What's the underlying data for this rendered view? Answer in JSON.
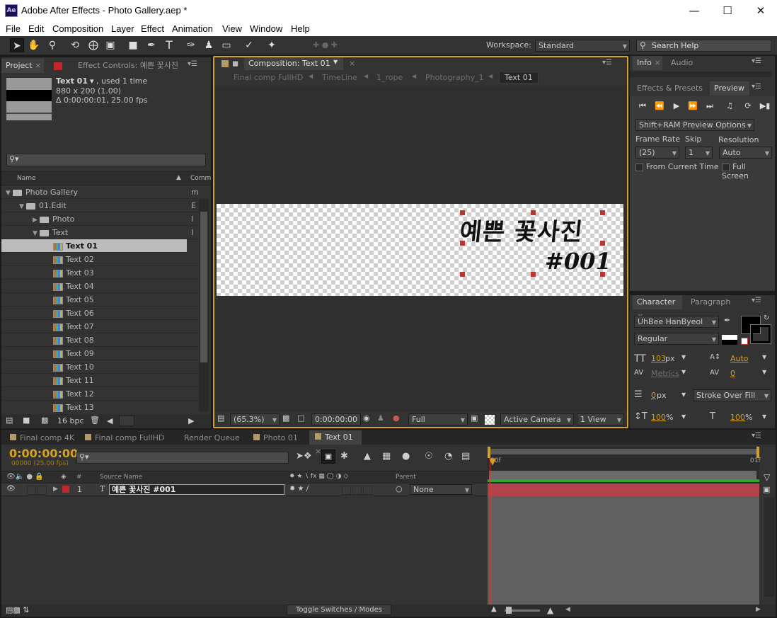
{
  "app": {
    "title": "Adobe After Effects - Photo Gallery.aep *",
    "icon": "Ae"
  },
  "menu": [
    "File",
    "Edit",
    "Composition",
    "Layer",
    "Effect",
    "Animation",
    "View",
    "Window",
    "Help"
  ],
  "toolbar": {
    "workspace_label": "Workspace:",
    "workspace_value": "Standard",
    "search_placeholder": "Search Help"
  },
  "project": {
    "tab_label": "Project",
    "effect_controls_label": "Effect Controls: 예쁜 꽃사진",
    "item_name": "Text 01",
    "item_used": ", used 1 time",
    "item_dims": "880 x 200 (1.00)",
    "item_duration": "Δ 0:00:00:01, 25.00 fps",
    "col_name": "Name",
    "col_comment": "Comm",
    "rows": [
      {
        "label": "Photo Gallery",
        "indent": 0,
        "kind": "folder",
        "open": true,
        "comment": "m"
      },
      {
        "label": "01.Edit",
        "indent": 1,
        "kind": "folder",
        "open": true,
        "comment": "E"
      },
      {
        "label": "Photo",
        "indent": 2,
        "kind": "folder",
        "open": false,
        "comment": "I"
      },
      {
        "label": "Text",
        "indent": 2,
        "kind": "folder",
        "open": true,
        "comment": "I"
      },
      {
        "label": "Text 01",
        "indent": 3,
        "kind": "comp",
        "selected": true
      },
      {
        "label": "Text 02",
        "indent": 3,
        "kind": "comp"
      },
      {
        "label": "Text 03",
        "indent": 3,
        "kind": "comp"
      },
      {
        "label": "Text 04",
        "indent": 3,
        "kind": "comp"
      },
      {
        "label": "Text 05",
        "indent": 3,
        "kind": "comp"
      },
      {
        "label": "Text 06",
        "indent": 3,
        "kind": "comp"
      },
      {
        "label": "Text 07",
        "indent": 3,
        "kind": "comp"
      },
      {
        "label": "Text 08",
        "indent": 3,
        "kind": "comp"
      },
      {
        "label": "Text 09",
        "indent": 3,
        "kind": "comp"
      },
      {
        "label": "Text 10",
        "indent": 3,
        "kind": "comp"
      },
      {
        "label": "Text 11",
        "indent": 3,
        "kind": "comp"
      },
      {
        "label": "Text 12",
        "indent": 3,
        "kind": "comp"
      },
      {
        "label": "Text 13",
        "indent": 3,
        "kind": "comp"
      }
    ],
    "bpc": "16 bpc"
  },
  "composition": {
    "tab_label": "Composition: Text 01",
    "breadcrumbs": [
      "Final comp FullHD",
      "TimeLine",
      "1_rope",
      "Photography_1"
    ],
    "breadcrumb_active": "Text 01",
    "text_line1": "예쁜 꽃사진",
    "text_line2": "#001",
    "zoom": "(65.3%)",
    "timecode": "0:00:00:00",
    "quality": "Full",
    "camera": "Active Camera",
    "views": "1 View"
  },
  "info": {
    "tab_info": "Info",
    "tab_audio": "Audio",
    "tab_effects": "Effects & Presets",
    "tab_preview": "Preview",
    "preview_options": "Shift+RAM Preview Options",
    "frame_rate_label": "Frame Rate",
    "frame_rate": "(25)",
    "skip_label": "Skip",
    "skip": "1",
    "resolution_label": "Resolution",
    "resolution": "Auto",
    "from_current": "From Current Time",
    "full_screen": "Full Screen"
  },
  "character": {
    "tab_character": "Character",
    "tab_paragraph": "Paragraph",
    "font": "UhBee HanByeol",
    "style": "Regular",
    "size": "103",
    "size_unit": "px",
    "leading": "Auto",
    "kerning": "Metrics",
    "tracking": "0",
    "stroke": "0",
    "stroke_unit": "px",
    "stroke_type": "Stroke Over Fill",
    "vscale": "100",
    "hscale": "100",
    "pct": "%"
  },
  "timeline": {
    "tabs": [
      "Final comp 4K",
      "Final comp FullHD",
      "Render Queue",
      "Photo 01",
      "Text 01"
    ],
    "active_tab": "Text 01",
    "timecode": "0:00:00:00",
    "frames": "00000 (25.00 fps)",
    "col_source": "Source Name",
    "col_parent": "Parent",
    "layer_num": "1",
    "layer_name": "예쁜 꽃사진 #001",
    "parent": "None",
    "ruler_start": "00f",
    "ruler_end": "01f",
    "toggle": "Toggle Switches / Modes"
  },
  "colors": {
    "accent": "#d4a022",
    "label_red": "#c0282e",
    "layer_bar": "#b2434d"
  }
}
